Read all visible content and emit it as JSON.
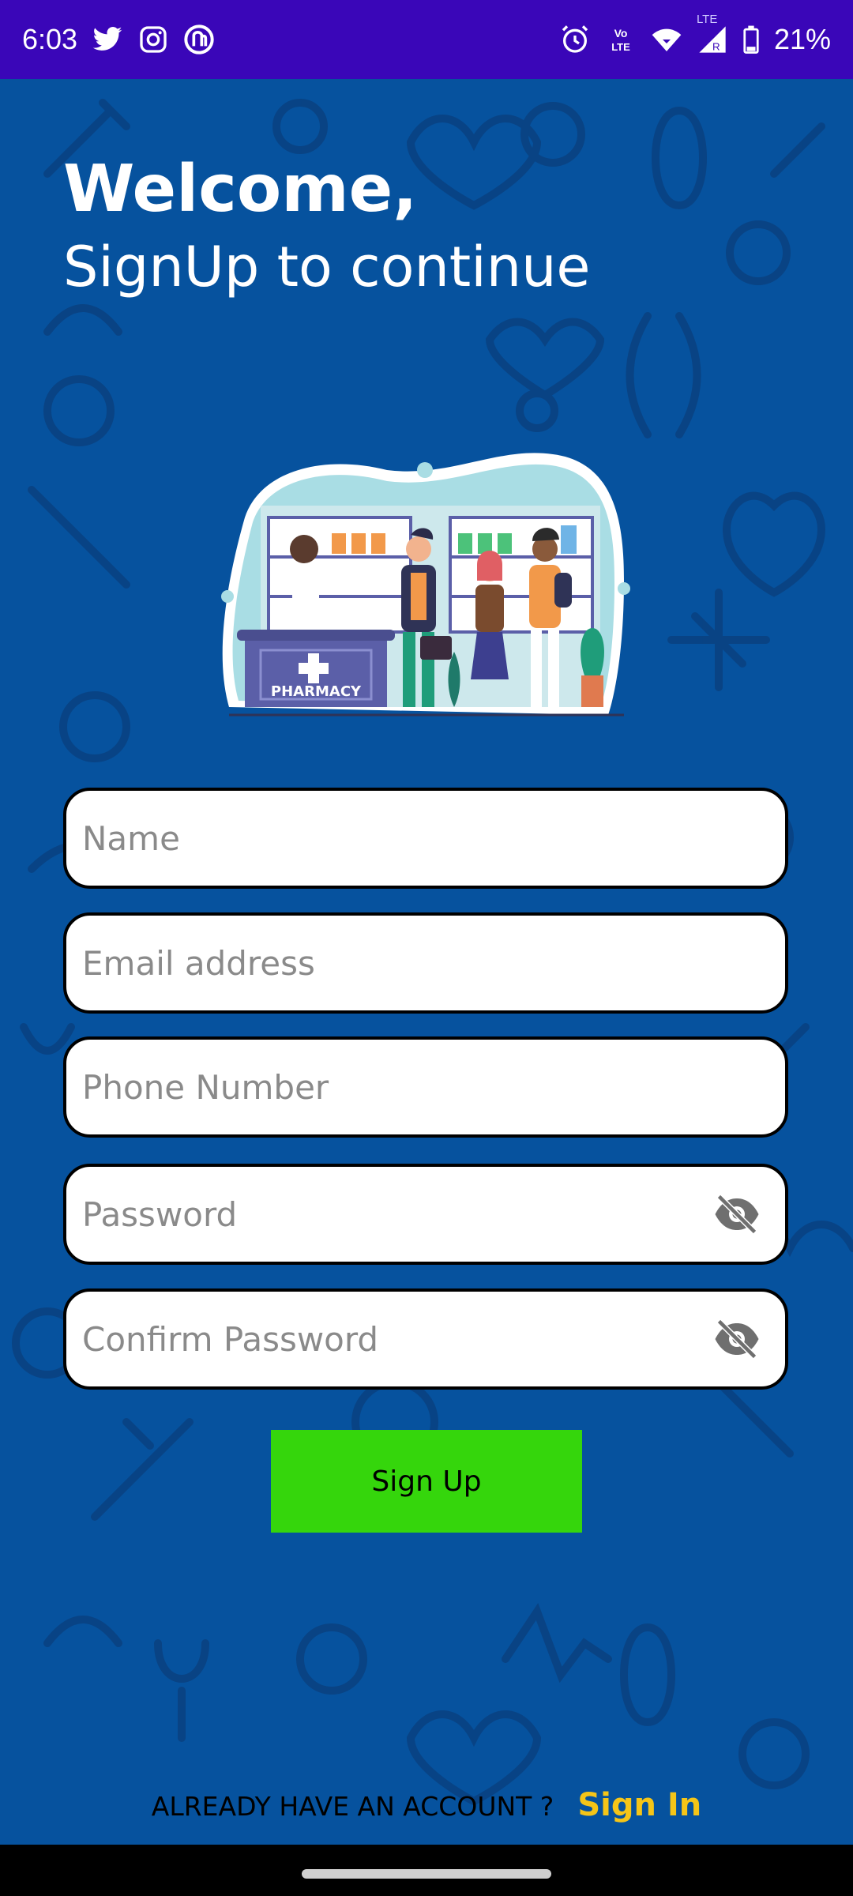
{
  "status_bar": {
    "time": "6:03",
    "battery": "21%",
    "left_icons": [
      "twitter-icon",
      "instagram-icon",
      "app-icon"
    ],
    "right_icons": [
      "alarm-icon",
      "volte-icon",
      "wifi-icon",
      "signal-icon",
      "battery-icon"
    ],
    "volte_text": "Vo LTE",
    "lte_text": "LTE"
  },
  "header": {
    "line1": "Welcome,",
    "line2": "SignUp to continue"
  },
  "illustration": {
    "sign_text": "PHARMACY"
  },
  "form": {
    "name_placeholder": "Name",
    "email_placeholder": "Email address",
    "phone_placeholder": "Phone Number",
    "password_placeholder": "Password",
    "confirm_password_placeholder": "Confirm Password"
  },
  "signup_button": "Sign Up",
  "footer": {
    "question": "ALREADY HAVE AN ACCOUNT ?",
    "link": "Sign In"
  },
  "colors": {
    "background": "#06529e",
    "status_bar": "#3a06b8",
    "button": "#35d60c",
    "link": "#f5c518"
  }
}
